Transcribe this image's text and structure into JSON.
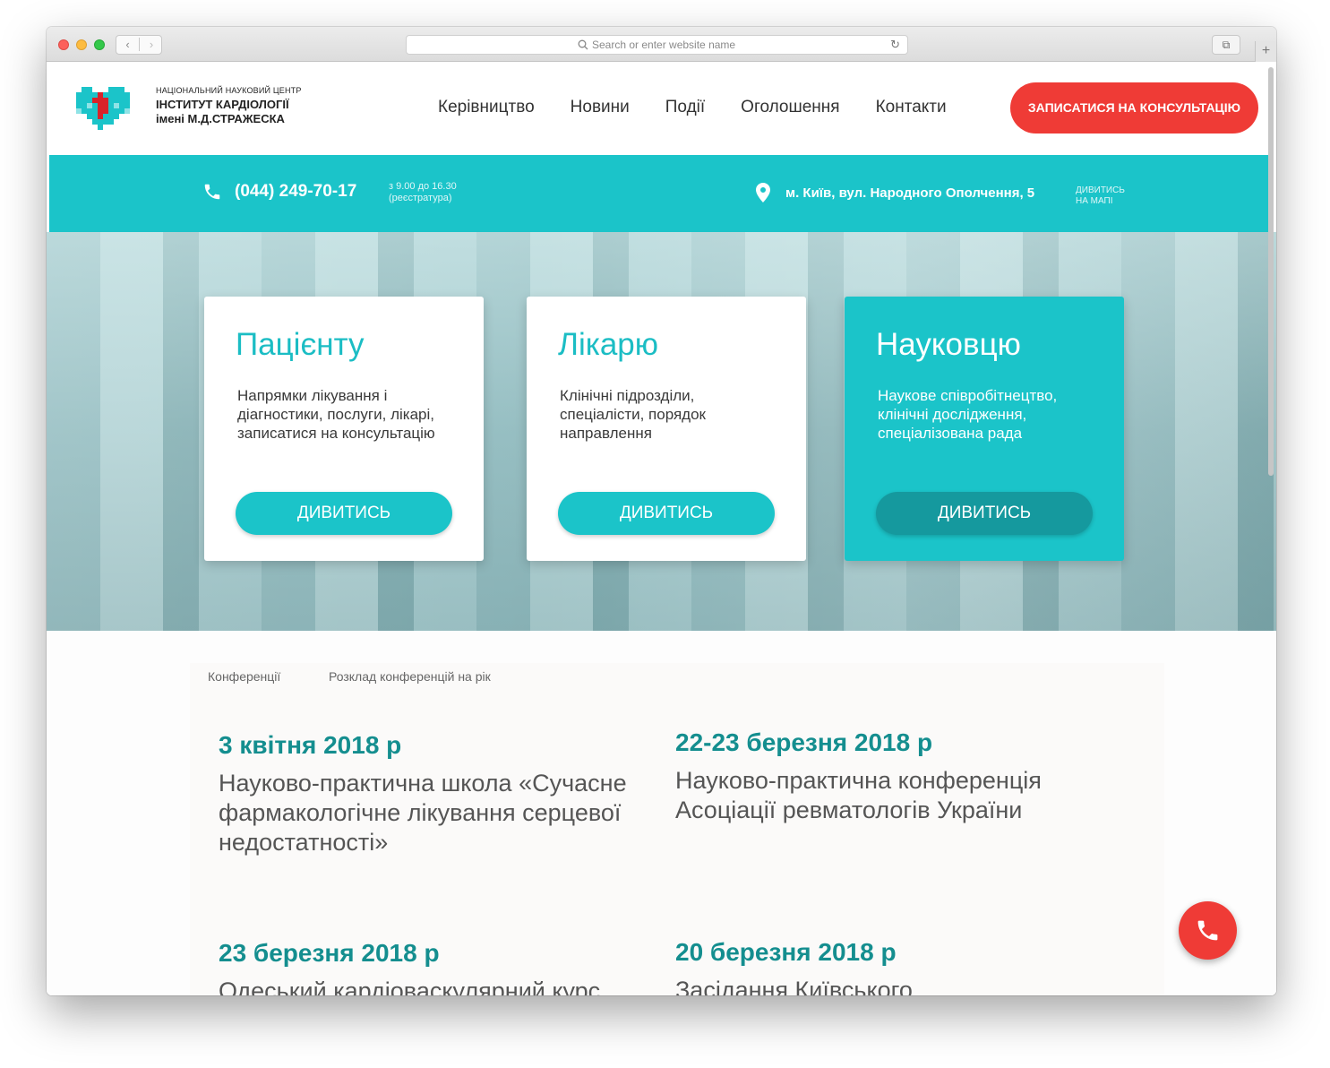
{
  "browser": {
    "url_placeholder": "Search or enter website name"
  },
  "header": {
    "logo_line1": "Національний науковий центр",
    "logo_line2": "ІНСТИТУТ КАРДІОЛОГІЇ",
    "logo_line3": "імені М.Д.СТРАЖЕСКА",
    "nav": [
      "Керівництво",
      "Новини",
      "Події",
      "Оголошення",
      "Контакти"
    ],
    "cta": "ЗАПИСАТИСЯ НА КОНСУЛЬТАЦІЮ"
  },
  "infobar": {
    "phone": "(044) 249-70-17",
    "hours_line1": "з 9.00 до 16.30",
    "hours_line2": "(реєстратура)",
    "address": "м. Київ, вул. Народного Ополчення, 5",
    "map_line1": "дивитись",
    "map_line2": "на мапі"
  },
  "cards": [
    {
      "title": "Пацієнту",
      "text": "Напрямки лікування і діагностики, послуги, лікарі, записатися на консультацію",
      "button": "ДИВИТИСЬ"
    },
    {
      "title": "Лікарю",
      "text": "Клінічні підрозділи, спеціалісти, порядок направлення",
      "button": "ДИВИТИСЬ"
    },
    {
      "title": "Науковцю",
      "text": "Наукове співробітнецтво, клінічні дослідження, спеціалізована рада",
      "button": "ДИВИТИСЬ"
    }
  ],
  "subnav": [
    "Конференції",
    "Розклад конференцій на рік"
  ],
  "events": [
    {
      "date": "3 квітня 2018 р",
      "title": "Науково-практична школа «Сучасне фармакологічне лікування серцевої недостатності»"
    },
    {
      "date": "22-23 березня 2018 р",
      "title": "Науково-практична конференція Асоціації ревматологів України"
    },
    {
      "date": "23 березня 2018 р",
      "title": "Одеський кардіоваскулярний курс"
    },
    {
      "date": "20 березня 2018 р",
      "title": "Засідання Київського"
    }
  ],
  "colors": {
    "accent": "#1bc4c9",
    "accent_dark": "#15999e",
    "cta_red": "#ef3b36",
    "date_teal": "#148e8f"
  },
  "icons": {
    "phone": "phone-icon",
    "location": "map-pin-icon",
    "fab": "phone-icon"
  }
}
